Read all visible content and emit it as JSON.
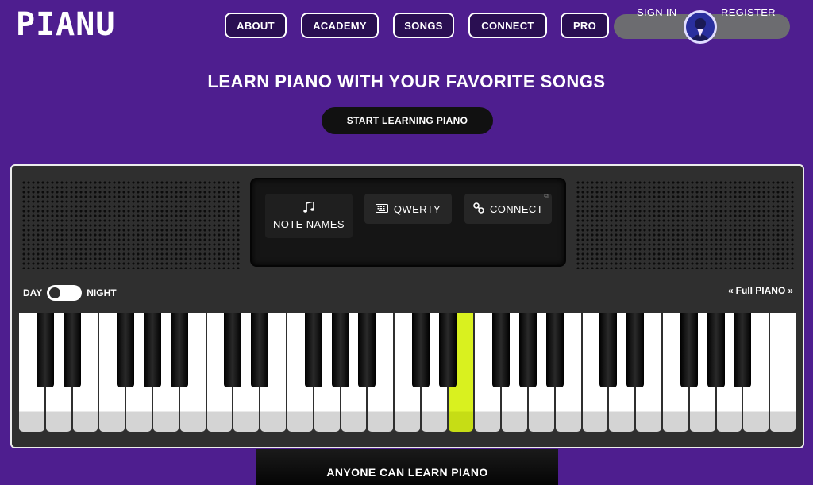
{
  "header": {
    "logo": "PIANU",
    "nav": [
      "ABOUT",
      "ACADEMY",
      "SONGS",
      "CONNECT",
      "PRO"
    ],
    "sign_in": "SIGN IN",
    "register": "REGISTER"
  },
  "hero": {
    "title": "LEARN PIANO WITH YOUR FAVORITE SONGS",
    "cta": "START LEARNING PIANO"
  },
  "piano": {
    "modes": {
      "note_names": "NOTE NAMES",
      "qwerty": "QWERTY",
      "connect": "CONNECT"
    },
    "day_label": "DAY",
    "night_label": "NIGHT",
    "full_piano": "Full PIANO",
    "white_key_count": 29,
    "active_white_key_index": 16
  },
  "footer": {
    "tab_label": "ANYONE CAN LEARN PIANO"
  },
  "colors": {
    "background": "#4e1e8f",
    "accent": "#d9f11f",
    "panel": "#2f2f2f"
  },
  "icons": [
    "music-note-icon",
    "keyboard-icon",
    "link-icon",
    "avatar-icon",
    "chevron-double-left-icon",
    "chevron-double-right-icon"
  ]
}
